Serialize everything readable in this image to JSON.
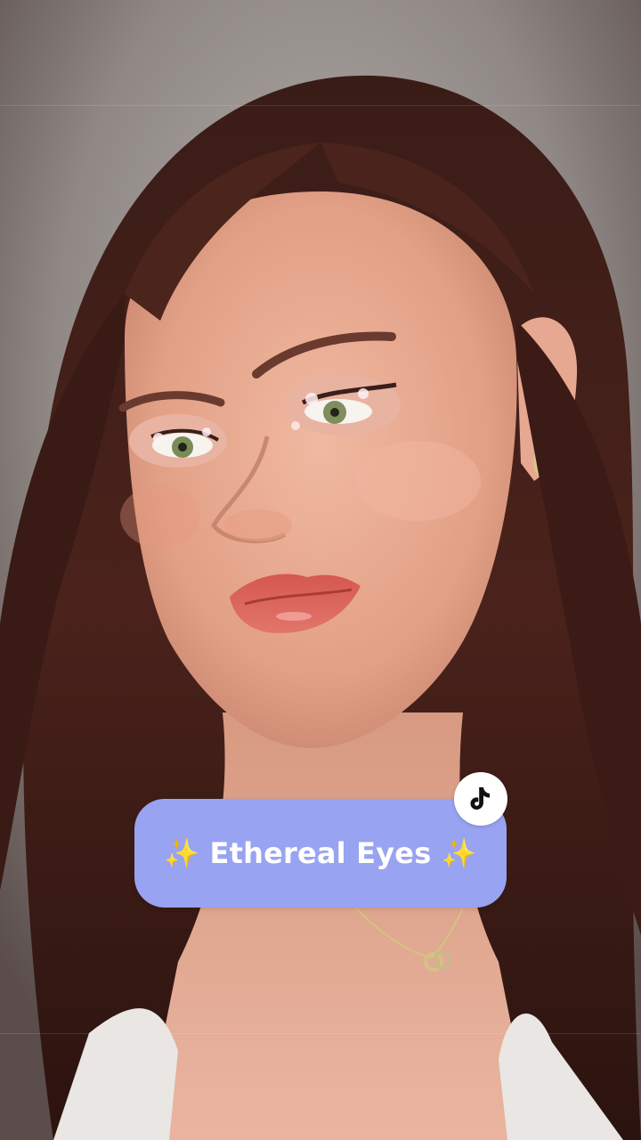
{
  "overlay": {
    "title": "✨ Ethereal Eyes ✨",
    "badge_icon": "tiktok-note-icon",
    "pill_color": "#98a3f2"
  }
}
